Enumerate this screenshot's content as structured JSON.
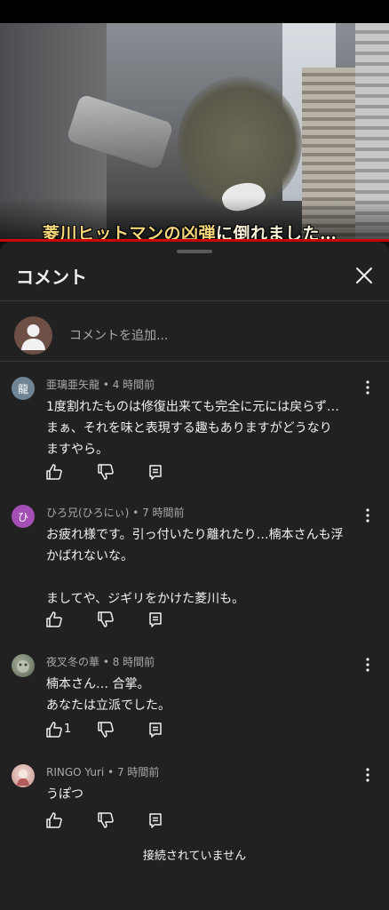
{
  "video": {
    "subtitle_highlight": "菱川ヒットマンの凶弾",
    "subtitle_rest": "に倒れました…"
  },
  "panel": {
    "title": "コメント",
    "close_icon": "close-icon",
    "add_comment_placeholder": "コメントを追加...",
    "status": "接続されていません"
  },
  "comments": [
    {
      "author": "亜璃亜矢龍",
      "age": "4 時間前",
      "avatar_letter": "龍",
      "avatar_color": "#6f8596",
      "text": "1度割れたものは修復出来ても完全に元には戻らず…\nまぁ、それを味と表現する趣もありますがどうなり\nますやら。",
      "likes": ""
    },
    {
      "author": "ひろ兄(ひろにぃ)",
      "age": "7 時間前",
      "avatar_letter": "ひ",
      "avatar_color": "#a34fb5",
      "text": "お疲れ様です。引っ付いたり離れたり…楠本さんも浮\nかばれないな。\n\nましてや、ジギリをかけた菱川も。",
      "likes": ""
    },
    {
      "author": "夜叉冬の華",
      "age": "8 時間前",
      "avatar_letter": "",
      "avatar_color": "#7b8a72",
      "text": "楠本さん… 合掌。\nあなたは立派でした。",
      "likes": "1"
    },
    {
      "author": "RINGO Yuri",
      "age": "7 時間前",
      "avatar_letter": "",
      "avatar_color": "#d9b3b0",
      "text": "うぽつ",
      "likes": ""
    }
  ],
  "meta_separator": " • ",
  "colors": {
    "sheet_bg": "#212121",
    "progress": "#cc0000",
    "text_secondary": "#aaaaaa"
  }
}
